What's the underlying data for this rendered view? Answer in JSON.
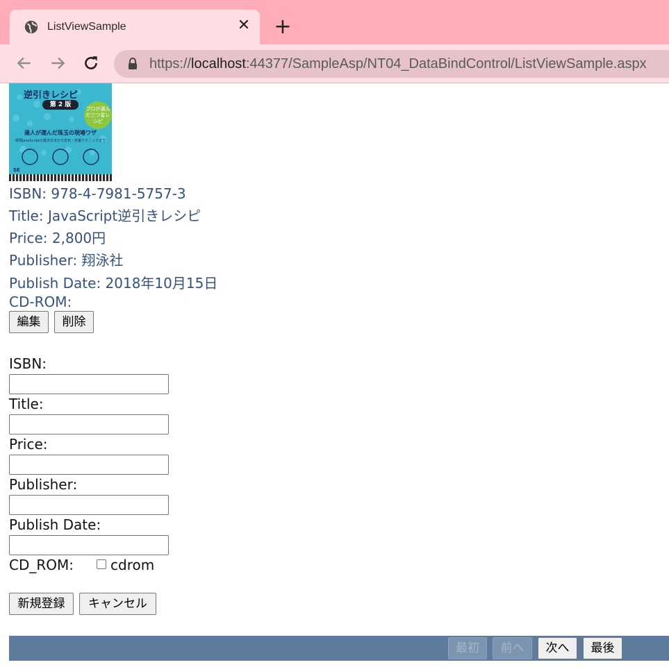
{
  "browser": {
    "tab_title": "ListViewSample",
    "close_glyph": "✕",
    "new_tab_glyph": "+",
    "url_scheme": "https://",
    "url_host": "localhost",
    "url_rest": ":44377/SampleAsp/NT04_DataBindControl/ListViewSample.aspx"
  },
  "cover": {
    "title": "逆引きレシピ",
    "edition": "第 2 版",
    "badge": "プロが選んだ三ツ星レシピ",
    "line1": "達人が選んだ珠玉の現場ワザ",
    "line2": "標準JavaScriptの基本文法から定石・定番テクニックまで"
  },
  "book": {
    "isbn": "ISBN: 978-4-7981-5757-3",
    "title": "Title: JavaScript逆引きレシピ",
    "price": "Price: 2,800円",
    "publisher": "Publisher: 翔泳社",
    "publish_date": "Publish Date: 2018年10月15日",
    "cdrom": "CD-ROM:",
    "edit_label": "編集",
    "delete_label": "削除"
  },
  "insert_form": {
    "isbn_label": "ISBN:",
    "title_label": "Title:",
    "price_label": "Price:",
    "publisher_label": "Publisher:",
    "publish_date_label": "Publish Date:",
    "cdrom_label": "CD_ROM:",
    "cdrom_checkbox_label": "cdrom",
    "cdrom_checked": false,
    "isbn_value": "",
    "title_value": "",
    "price_value": "",
    "publisher_value": "",
    "publish_date_value": "",
    "insert_label": "新規登録",
    "cancel_label": "キャンセル"
  },
  "pager": {
    "first_label": "最初",
    "prev_label": "前へ",
    "next_label": "次へ",
    "last_label": "最後",
    "background": "#5d7b9d"
  },
  "colors": {
    "chrome_top": "#ffadb9",
    "chrome_toolbar": "#ffdee3",
    "info_text": "#34527a"
  }
}
